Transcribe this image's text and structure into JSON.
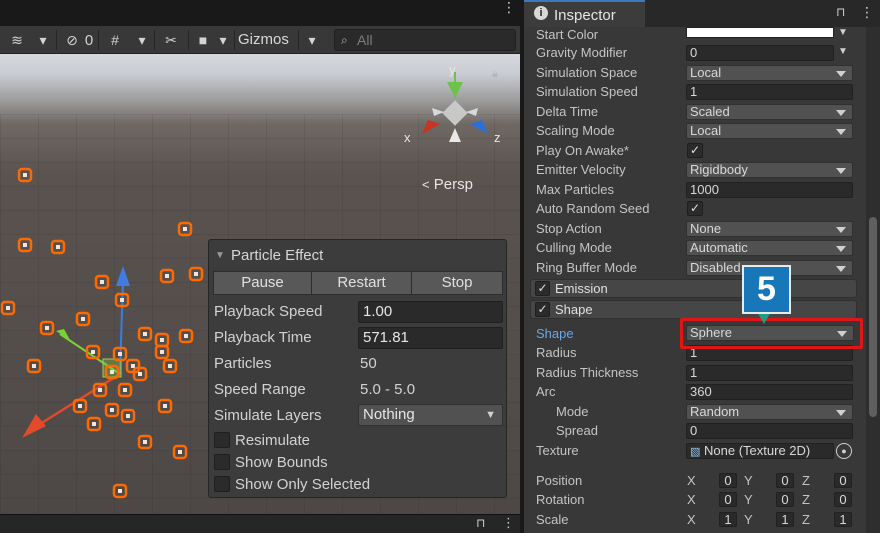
{
  "scene": {
    "toolbar": {
      "hidden_count": "0",
      "gizmos_label": "Gizmos",
      "search_placeholder": "All"
    },
    "persp_label": "Persp",
    "axis_labels": {
      "x": "x",
      "y": "y",
      "z": "z"
    },
    "particle_effect": {
      "title": "Particle Effect",
      "buttons": {
        "pause": "Pause",
        "restart": "Restart",
        "stop": "Stop"
      },
      "playback_speed_label": "Playback Speed",
      "playback_speed_value": "1.00",
      "playback_time_label": "Playback Time",
      "playback_time_value": "571.81",
      "particles_label": "Particles",
      "particles_value": "50",
      "speed_range_label": "Speed Range",
      "speed_range_value": "5.0 - 5.0",
      "simulate_layers_label": "Simulate Layers",
      "simulate_layers_value": "Nothing",
      "resimulate_label": "Resimulate",
      "show_bounds_label": "Show Bounds",
      "show_only_selected_label": "Show Only Selected"
    }
  },
  "inspector": {
    "tab_title": "Inspector",
    "rows": {
      "start_color": {
        "label": "Start Color"
      },
      "gravity_modifier": {
        "label": "Gravity Modifier",
        "value": "0"
      },
      "simulation_space": {
        "label": "Simulation Space",
        "value": "Local"
      },
      "simulation_speed": {
        "label": "Simulation Speed",
        "value": "1"
      },
      "delta_time": {
        "label": "Delta Time",
        "value": "Scaled"
      },
      "scaling_mode": {
        "label": "Scaling Mode",
        "value": "Local"
      },
      "play_on_awake": {
        "label": "Play On Awake*",
        "checked": true
      },
      "emitter_velocity": {
        "label": "Emitter Velocity",
        "value": "Rigidbody"
      },
      "max_particles": {
        "label": "Max Particles",
        "value": "1000"
      },
      "auto_random_seed": {
        "label": "Auto Random Seed",
        "checked": true
      },
      "stop_action": {
        "label": "Stop Action",
        "value": "None"
      },
      "culling_mode": {
        "label": "Culling Mode",
        "value": "Automatic"
      },
      "ring_buffer_mode": {
        "label": "Ring Buffer Mode",
        "value": "Disabled"
      }
    },
    "sections": {
      "emission": "Emission",
      "shape": "Shape"
    },
    "shape_module": {
      "shape": {
        "label": "Shape",
        "value": "Sphere"
      },
      "radius": {
        "label": "Radius",
        "value": "1"
      },
      "radius_thickness": {
        "label": "Radius Thickness",
        "value": "1"
      },
      "arc": {
        "label": "Arc",
        "value": "360"
      },
      "mode": {
        "label": "Mode",
        "value": "Random"
      },
      "spread": {
        "label": "Spread",
        "value": "0"
      },
      "texture": {
        "label": "Texture",
        "value": "None (Texture 2D)"
      },
      "position": {
        "label": "Position",
        "x": "0",
        "y": "0",
        "z": "0"
      },
      "rotation": {
        "label": "Rotation",
        "x": "0",
        "y": "0",
        "z": "0"
      },
      "scale": {
        "label": "Scale",
        "x": "1",
        "y": "1",
        "z": "1"
      },
      "axis": {
        "x": "X",
        "y": "Y",
        "z": "Z"
      }
    }
  },
  "callout": {
    "number": "5"
  },
  "colors": {
    "highlight": "#e01515",
    "badge": "#1877b8",
    "particle": "#ff6a00",
    "accent": "#3a79bb"
  }
}
